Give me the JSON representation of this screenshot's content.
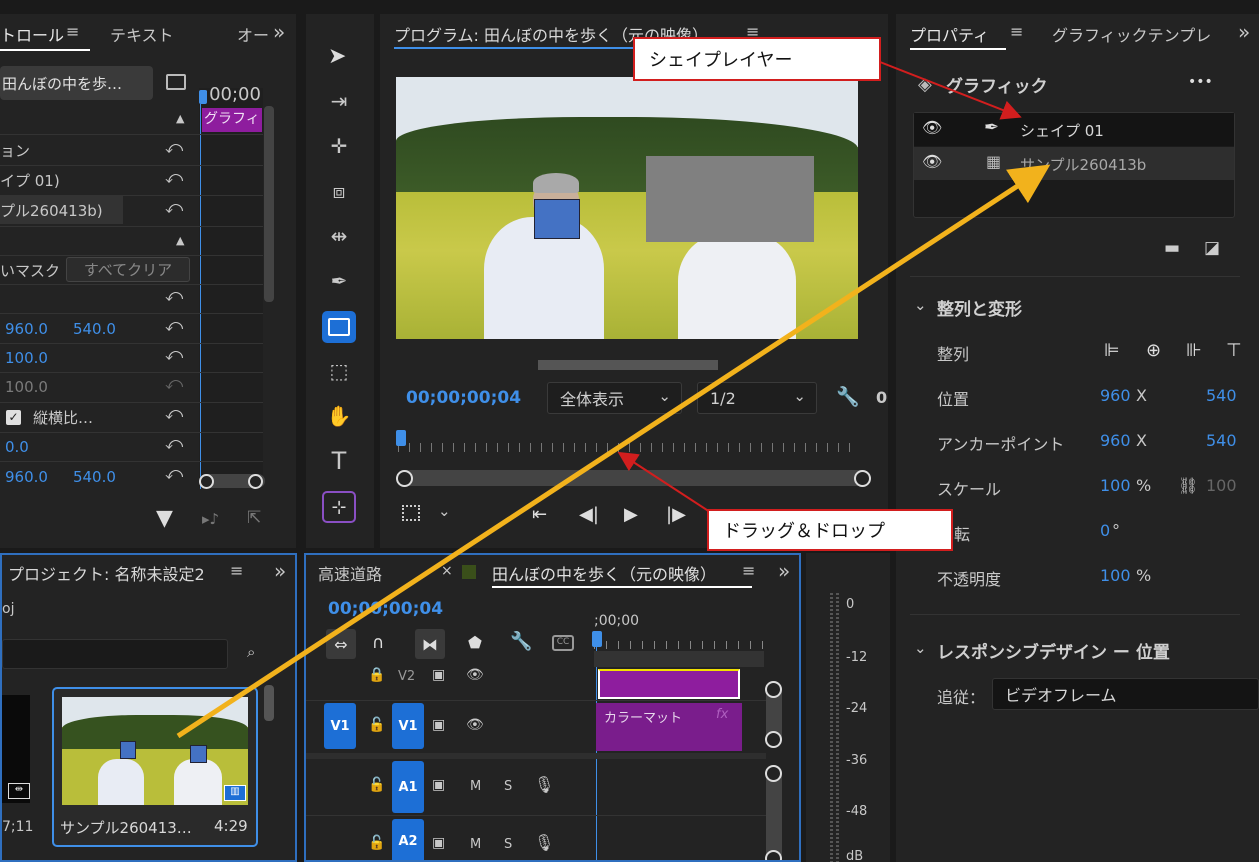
{
  "effect_controls": {
    "tab_active": "トロール",
    "tab_menu_glyph": "≡",
    "tab_text": "テキスト",
    "tab_audio": "オー",
    "more_glyph": "»",
    "clip_dropdown": "田んぼの中を歩…",
    "timecode_head": ";00;00",
    "mini_clip_label": "グラフィ",
    "rows": [
      {
        "label": "ョン"
      },
      {
        "label": "イプ 01)"
      },
      {
        "label": "プル260413b)"
      },
      {
        "label": "いマスク",
        "button": "すべてクリア"
      },
      {
        "v1": "960.0",
        "v2": "540.0"
      },
      {
        "v1": "100.0"
      },
      {
        "v1": "100.0"
      },
      {
        "checkbox": "縦横比…"
      },
      {
        "v1": "0.0"
      },
      {
        "v1": "960.0",
        "v2": "540.0"
      }
    ]
  },
  "program_monitor": {
    "title": "プログラム: 田んぼの中を歩く（元の映像）",
    "menu_glyph": "≡",
    "timecode": "00;00;00;04",
    "fit": "全体表示",
    "resolution": "1/2",
    "end_digit": "0"
  },
  "properties": {
    "tab_active": "プロパティ",
    "tab_menu_glyph": "≡",
    "tab_other": "グラフィックテンプレ",
    "more_glyph": "»",
    "section_graphic": "グラフィック",
    "dots": "•••",
    "layers": [
      {
        "name": "シェイプ 01",
        "icon": "pen-icon"
      },
      {
        "name": "サンプル260413b",
        "icon": "film-icon"
      }
    ],
    "section_align": "整列と変形",
    "align_label": "整列",
    "position_label": "位置",
    "position_x": "960",
    "position_y": "540",
    "anchor_label": "アンカーポイント",
    "anchor_x": "960",
    "anchor_y": "540",
    "x_unit": "X",
    "scale_label": "スケール",
    "scale_val": "100",
    "scale_unit": "%",
    "scale_val2": "100",
    "rotation_label": "転",
    "rotation_val": "0",
    "rotation_unit": "°",
    "opacity_label": "不透明度",
    "opacity_val": "100",
    "opacity_unit": "%",
    "section_responsive": "レスポンシブデザイン ー 位置",
    "follow_label": "追従：",
    "follow_value": "ビデオフレーム"
  },
  "project": {
    "title": "プロジェクト: 名称未設定2",
    "menu_glyph": "≡",
    "more_glyph": "»",
    "file_label": "oj",
    "clip_name": "サンプル260413…",
    "clip_duration": "4:29",
    "left_duration": "7;11"
  },
  "timeline": {
    "tab1": "高速道路",
    "close_glyph": "×",
    "tab2": "田んぼの中を歩く（元の映像）",
    "menu_glyph": "≡",
    "more_glyph": "»",
    "timecode": "00;00;00;04",
    "ruler_start": ";00;00",
    "v2_label": "V2",
    "v1_label": "V1",
    "a1_label": "A1",
    "a2_label": "A2",
    "mute": "M",
    "solo": "S",
    "clip_color_matte": "カラーマット",
    "fx": "fx"
  },
  "audio_meter": {
    "ticks": [
      "0",
      "-12",
      "-24",
      "-36",
      "-48",
      "dB"
    ]
  },
  "annotations": {
    "shape_layer": "シェイプレイヤー",
    "drag_drop": "ドラッグ＆ドロップ"
  },
  "colors": {
    "accent_blue": "#1d6fd6",
    "purple_clip": "#8e1d9e",
    "callout_red": "#d21e1e",
    "arrow_orange": "#f2b21c"
  }
}
